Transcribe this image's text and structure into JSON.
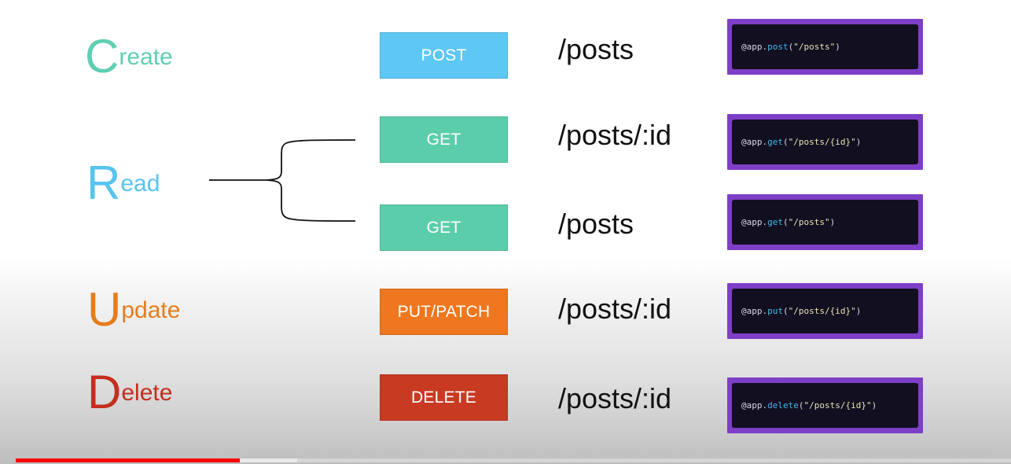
{
  "colors": {
    "create": "#5fcfb3",
    "read": "#58c3ef",
    "update": "#e57d1f",
    "delete": "#c32f1f",
    "post_box": "#5ec7f4",
    "get_box": "#5ccdaa",
    "put_box": "#ee771f",
    "delete_box": "#c83a22",
    "code_border": "#7d3fc6",
    "code_bg": "#120f20",
    "progress_played": "#ff0000"
  },
  "crud": {
    "create": {
      "letter": "C",
      "rest": "reate"
    },
    "read": {
      "letter": "R",
      "rest": "ead"
    },
    "update": {
      "letter": "U",
      "rest": "pdate"
    },
    "delete": {
      "letter": "D",
      "rest": "elete"
    }
  },
  "rows": [
    {
      "method": "POST",
      "path": "/posts",
      "code": {
        "prefix": "@app.",
        "fn": "post",
        "open": "(",
        "arg": "\"/posts\"",
        "close": ")"
      }
    },
    {
      "method": "GET",
      "path": "/posts/:id",
      "code": {
        "prefix": "@app.",
        "fn": "get",
        "open": "(",
        "arg": "\"/posts/{id}\"",
        "close": ")"
      }
    },
    {
      "method": "GET",
      "path": "/posts",
      "code": {
        "prefix": "@app.",
        "fn": "get",
        "open": "(",
        "arg": "\"/posts\"",
        "close": ")"
      }
    },
    {
      "method": "PUT/PATCH",
      "path": "/posts/:id",
      "code": {
        "prefix": "@app.",
        "fn": "put",
        "open": "(",
        "arg": "\"/posts/{id}\"",
        "close": ")"
      }
    },
    {
      "method": "DELETE",
      "path": "/posts/:id",
      "code": {
        "prefix": "@app.",
        "fn": "delete",
        "open": "(",
        "arg": "\"/posts/{id}\"",
        "close": ")"
      }
    }
  ],
  "player": {
    "progress_played_fraction": 0.225,
    "progress_buffered_fraction": 0.283
  }
}
